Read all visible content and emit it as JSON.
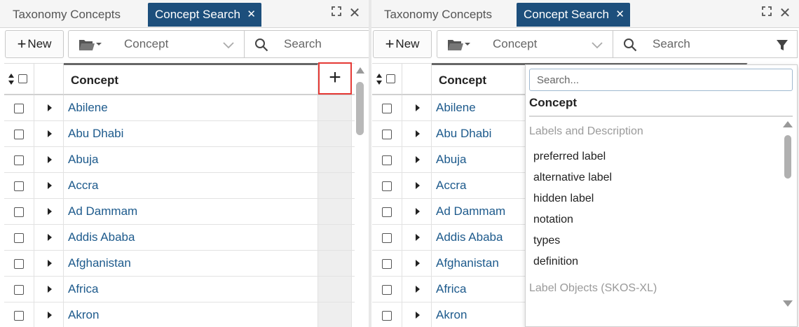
{
  "left_panel": {
    "tabs": [
      {
        "label": "Taxonomy Concepts",
        "active": false
      },
      {
        "label": "Concept Search",
        "active": true
      }
    ],
    "toolbar": {
      "new_label": "New",
      "selector_value": "Concept",
      "search_placeholder": "Search"
    },
    "grid": {
      "column_header": "Concept",
      "add_column_symbol": "+",
      "rows": [
        "Abilene",
        "Abu Dhabi",
        "Abuja",
        "Accra",
        "Ad Dammam",
        "Addis Ababa",
        "Afghanistan",
        "Africa",
        "Akron"
      ]
    }
  },
  "right_panel": {
    "tabs": [
      {
        "label": "Taxonomy Concepts",
        "active": false
      },
      {
        "label": "Concept Search",
        "active": true
      }
    ],
    "toolbar": {
      "new_label": "New",
      "selector_value": "Concept",
      "search_placeholder": "Search"
    },
    "grid": {
      "column_header": "Concept",
      "rows": [
        "Abilene",
        "Abu Dhabi",
        "Abuja",
        "Accra",
        "Ad Dammam",
        "Addis Ababa",
        "Afghanistan",
        "Africa",
        "Akron"
      ]
    },
    "column_dropdown": {
      "search_placeholder": "Search...",
      "selected_header": "Concept",
      "groups": [
        {
          "label": "Labels and Description",
          "items": [
            "preferred label",
            "alternative label",
            "hidden label",
            "notation",
            "types",
            "definition"
          ]
        },
        {
          "label": "Label Objects (SKOS-XL)",
          "items": []
        }
      ]
    }
  },
  "icons": {
    "close": "✕",
    "maximize": "maximize-icon",
    "folder": "folder-icon",
    "search": "search-icon",
    "filter": "filter-icon"
  },
  "colors": {
    "active_tab": "#1d4f7c",
    "link": "#1d5a8c",
    "highlight_border": "#e53935"
  }
}
